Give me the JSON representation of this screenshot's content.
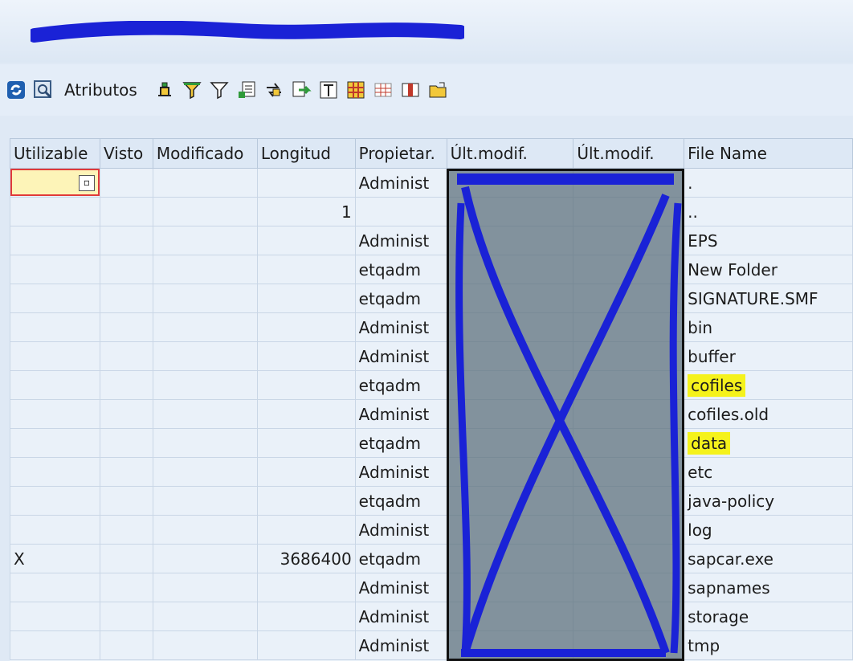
{
  "toolbar": {
    "attributes_label": "Atributos",
    "icons": [
      "refresh-icon",
      "find-icon",
      "sort-ascending-icon",
      "filter-icon",
      "filter-set-icon",
      "export-icon",
      "details-icon",
      "move-icon",
      "total-icon",
      "layout-icon",
      "grid-icon",
      "column-icon",
      "choose-layout-icon",
      "folder-icon"
    ]
  },
  "table": {
    "headers": [
      "Utilizable",
      "Visto",
      "Modificado",
      "Longitud",
      "Propietar.",
      "Últ.modif.",
      "Últ.modif.",
      "File Name"
    ],
    "rows": [
      {
        "utilizable": "",
        "longitud": "",
        "propietario": "Administ",
        "fecha": "",
        "hora": "",
        "filename": "."
      },
      {
        "utilizable": "",
        "longitud": "1",
        "propietario": "",
        "fecha": "",
        "hora": "",
        "filename": ".."
      },
      {
        "utilizable": "",
        "longitud": "",
        "propietario": "Administ",
        "fecha": "",
        "hora": "",
        "filename": "EPS"
      },
      {
        "utilizable": "",
        "longitud": "",
        "propietario": "etqadm",
        "fecha": "",
        "hora": "",
        "filename": "New Folder"
      },
      {
        "utilizable": "",
        "longitud": "",
        "propietario": "etqadm",
        "fecha": "",
        "hora": "",
        "filename": "SIGNATURE.SMF"
      },
      {
        "utilizable": "",
        "longitud": "",
        "propietario": "Administ",
        "fecha": "",
        "hora": "",
        "filename": "bin"
      },
      {
        "utilizable": "",
        "longitud": "",
        "propietario": "Administ",
        "fecha": "",
        "hora": "",
        "filename": "buffer"
      },
      {
        "utilizable": "",
        "longitud": "",
        "propietario": "etqadm",
        "fecha": "",
        "hora": "",
        "filename": "cofiles",
        "highlight": true
      },
      {
        "utilizable": "",
        "longitud": "",
        "propietario": "Administ",
        "fecha": "",
        "hora": "",
        "filename": "cofiles.old"
      },
      {
        "utilizable": "",
        "longitud": "",
        "propietario": "etqadm",
        "fecha": "",
        "hora": "",
        "filename": "data",
        "highlight": true
      },
      {
        "utilizable": "",
        "longitud": "",
        "propietario": "Administ",
        "fecha": "",
        "hora": "",
        "filename": "etc"
      },
      {
        "utilizable": "",
        "longitud": "",
        "propietario": "etqadm",
        "fecha": "",
        "hora": "",
        "filename": "java-policy"
      },
      {
        "utilizable": "",
        "longitud": "",
        "propietario": "Administ",
        "fecha": "",
        "hora": "",
        "filename": "log"
      },
      {
        "utilizable": "X",
        "longitud": "3686400",
        "propietario": "etqadm",
        "fecha": "",
        "hora": "",
        "filename": "sapcar.exe"
      },
      {
        "utilizable": "",
        "longitud": "",
        "propietario": "Administ",
        "fecha": "",
        "hora": "",
        "filename": "sapnames"
      },
      {
        "utilizable": "",
        "longitud": "",
        "propietario": "Administ",
        "fecha": "",
        "hora": "",
        "filename": "storage"
      },
      {
        "utilizable": "",
        "longitud": "",
        "propietario": "Administ",
        "fecha": "",
        "hora": "",
        "filename": "tmp"
      }
    ]
  },
  "colors": {
    "background": "#dfe9f5",
    "highlight": "#f5f21c",
    "selection_border": "#e03a3a",
    "scribble": "#1a22d6"
  }
}
